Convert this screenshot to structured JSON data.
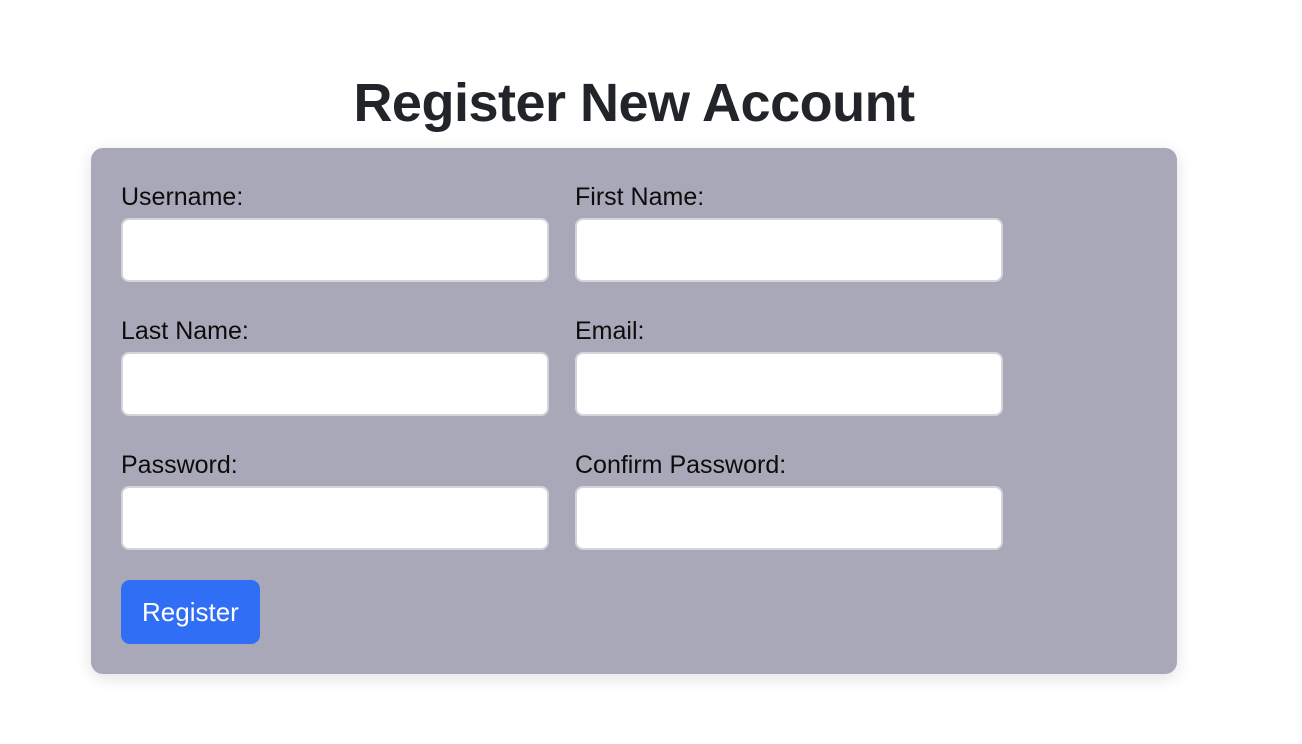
{
  "page": {
    "title": "Register New Account"
  },
  "form": {
    "fields": [
      {
        "label": "Username:",
        "value": "",
        "placeholder": ""
      },
      {
        "label": "First Name:",
        "value": "",
        "placeholder": ""
      },
      {
        "label": "Last Name:",
        "value": "",
        "placeholder": ""
      },
      {
        "label": "Email:",
        "value": "",
        "placeholder": ""
      },
      {
        "label": "Password:",
        "value": "",
        "placeholder": ""
      },
      {
        "label": "Confirm Password:",
        "value": "",
        "placeholder": ""
      }
    ],
    "submit_label": "Register"
  },
  "colors": {
    "card_background": "#a9a8b8",
    "button_background": "#306ef5",
    "title_text": "#212529"
  }
}
